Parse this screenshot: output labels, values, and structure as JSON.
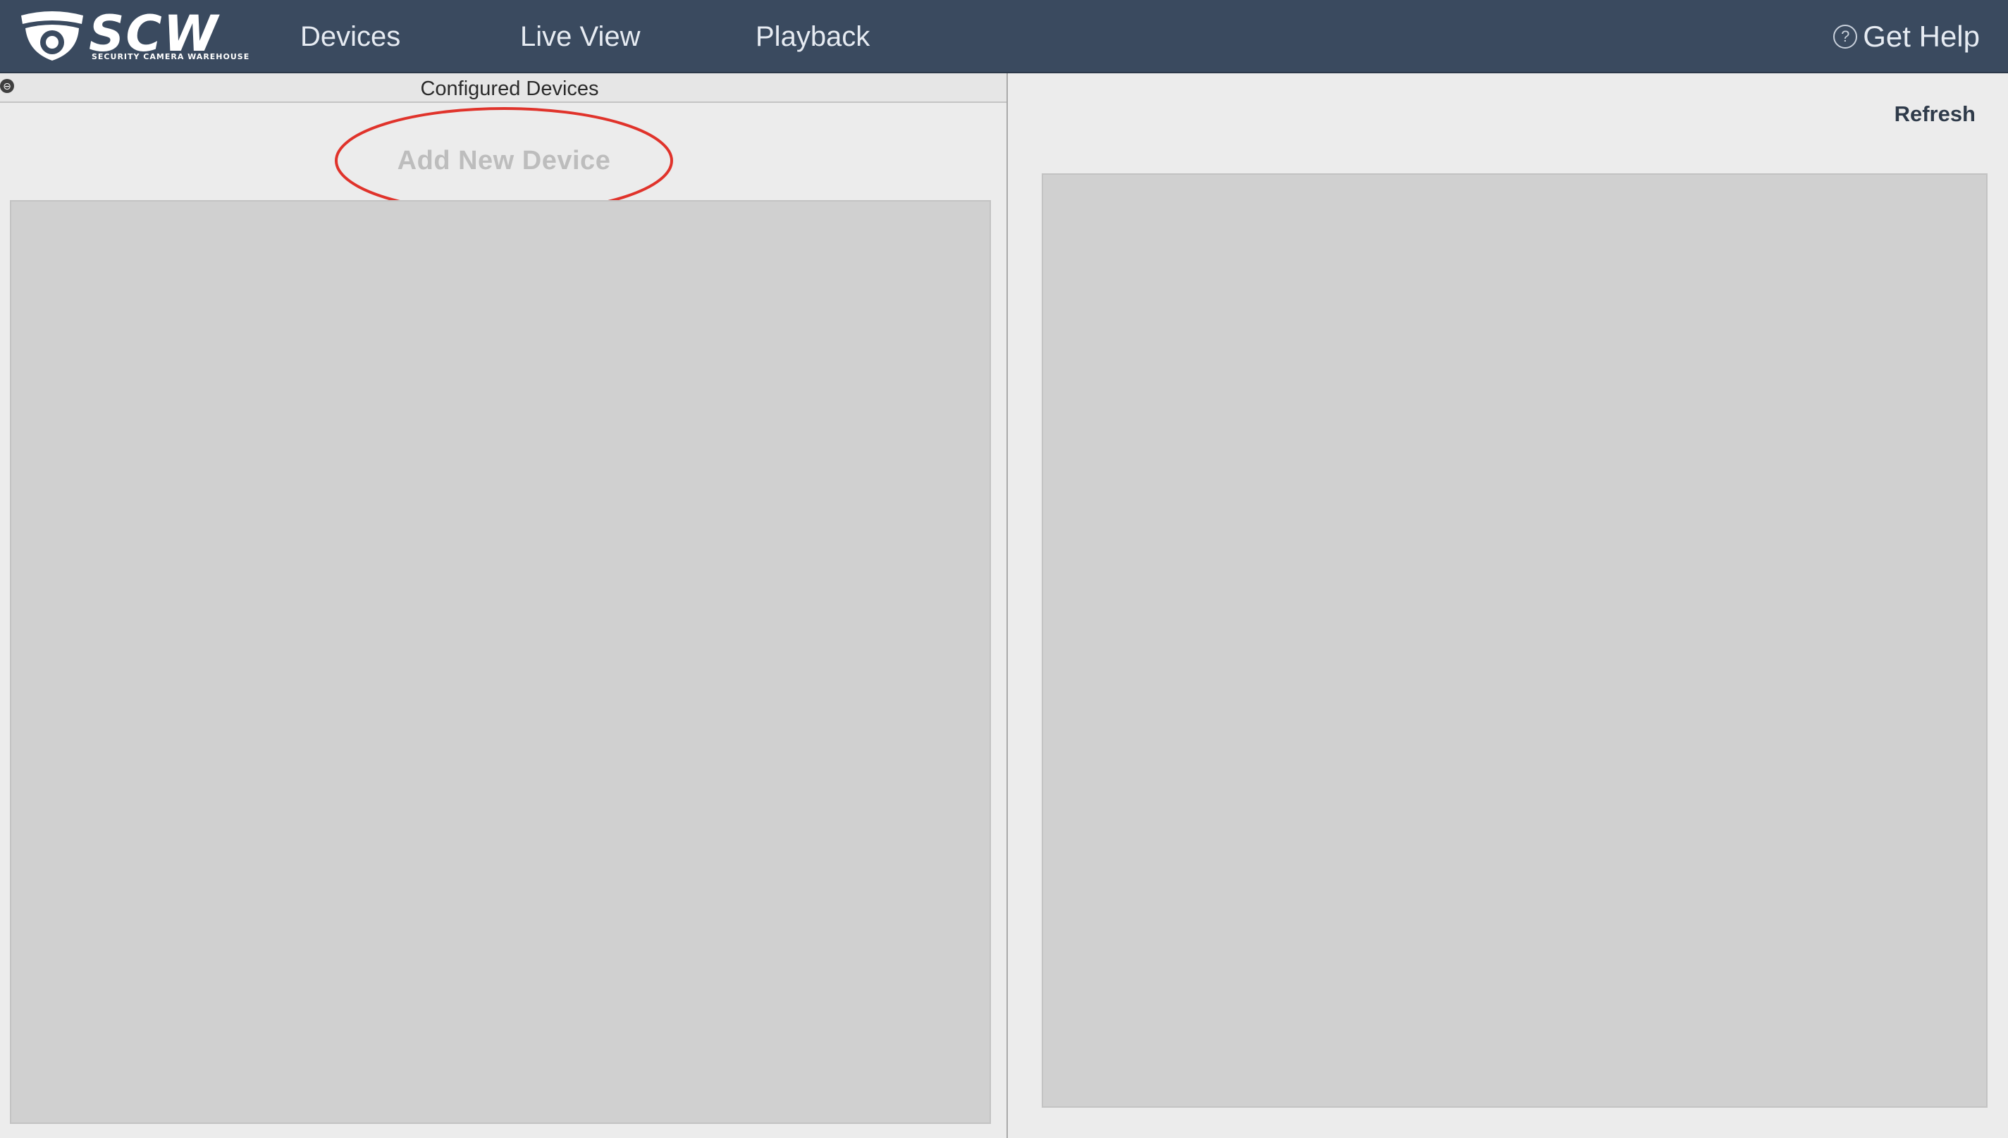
{
  "app": {
    "logo_text": "SCW",
    "logo_tagline": "SECURITY CAMERA WAREHOUSE"
  },
  "nav": {
    "items": [
      {
        "label": "Devices"
      },
      {
        "label": "Live View"
      },
      {
        "label": "Playback"
      }
    ],
    "help_icon_glyph": "?",
    "help_label": "Get Help"
  },
  "left_panel": {
    "title": "Configured Devices",
    "collapse_icon_glyph": "⊖",
    "add_device_label": "Add New Device",
    "devices": []
  },
  "right_panel": {
    "refresh_label": "Refresh"
  },
  "colors": {
    "topbar": "#3a4a5f",
    "highlight_ring": "#e0332b",
    "panel_bg": "#ececec",
    "list_bg": "#d0d0d0"
  },
  "icons": {
    "logo": "camera-dome-icon",
    "help": "question-circle-icon",
    "collapse": "collapse-icon"
  }
}
